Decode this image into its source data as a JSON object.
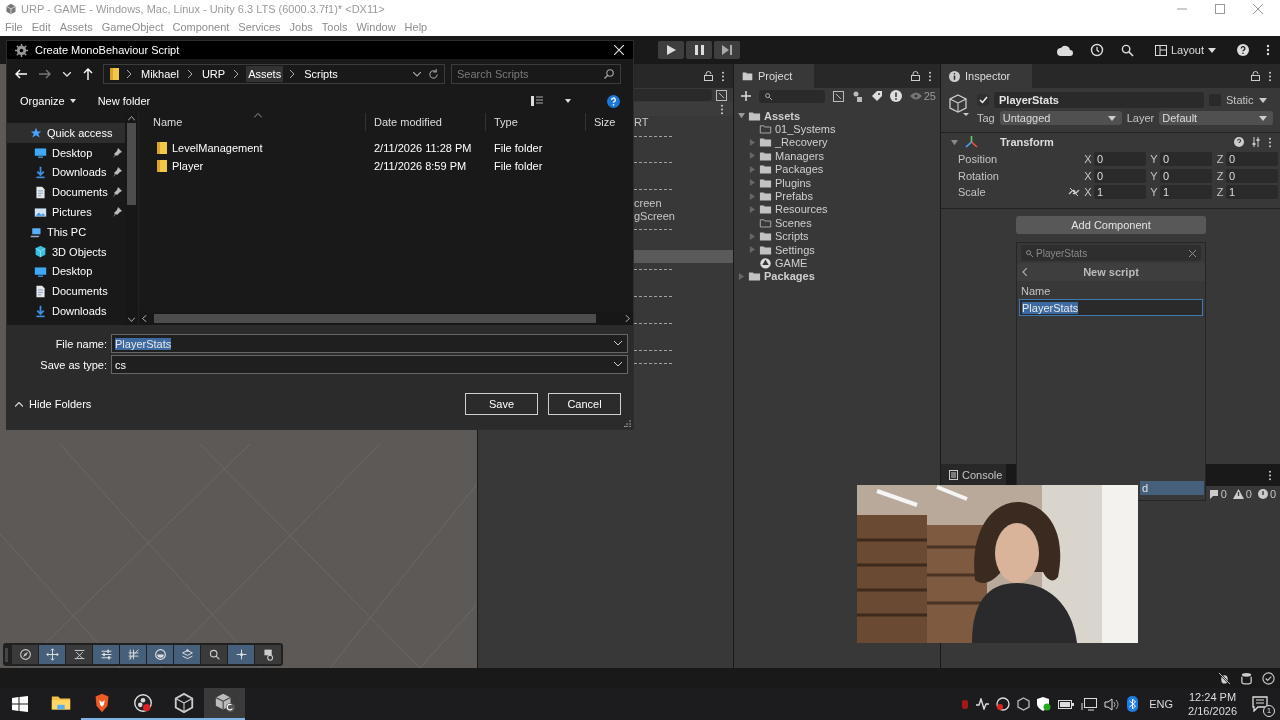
{
  "window": {
    "title": "URP - GAME - Windows, Mac, Linux - Unity 6.3 LTS (6000.3.7f1)* <DX11>"
  },
  "menu": [
    "File",
    "Edit",
    "Assets",
    "GameObject",
    "Component",
    "Services",
    "Jobs",
    "Tools",
    "Window",
    "Help"
  ],
  "toolbar": {
    "layout": "Layout"
  },
  "hierarchy": {
    "rows": [
      {
        "kind": "label",
        "text": "RT"
      },
      {
        "kind": "separator"
      },
      {
        "kind": "blank",
        "selected": false
      },
      {
        "kind": "separator"
      },
      {
        "kind": "blank",
        "selected": false
      },
      {
        "kind": "separator"
      },
      {
        "kind": "label",
        "text": "creen"
      },
      {
        "kind": "label",
        "text": "gScreen"
      },
      {
        "kind": "separator"
      },
      {
        "kind": "blank",
        "selected": false
      },
      {
        "kind": "blank",
        "selected": true
      },
      {
        "kind": "separator"
      },
      {
        "kind": "blank",
        "selected": false
      },
      {
        "kind": "separator"
      },
      {
        "kind": "blank",
        "selected": false
      },
      {
        "kind": "separator"
      },
      {
        "kind": "blank",
        "selected": false
      },
      {
        "kind": "separator"
      },
      {
        "kind": "separator"
      }
    ]
  },
  "project": {
    "tab": "Project",
    "count": "25",
    "tree": [
      {
        "label": "Assets",
        "kind": "folder",
        "expanded": true,
        "children": [
          {
            "label": "01_Systems",
            "kind": "empty-folder"
          },
          {
            "label": "_Recovery",
            "kind": "folder",
            "expanded": false
          },
          {
            "label": "Managers",
            "kind": "folder",
            "expanded": false
          },
          {
            "label": "Packages",
            "kind": "folder",
            "expanded": false
          },
          {
            "label": "Plugins",
            "kind": "folder",
            "expanded": false
          },
          {
            "label": "Prefabs",
            "kind": "folder",
            "expanded": false
          },
          {
            "label": "Resources",
            "kind": "folder",
            "expanded": false
          },
          {
            "label": "Scenes",
            "kind": "empty-folder"
          },
          {
            "label": "Scripts",
            "kind": "folder",
            "expanded": false
          },
          {
            "label": "Settings",
            "kind": "folder",
            "expanded": false
          },
          {
            "label": "GAME",
            "kind": "scene"
          }
        ]
      },
      {
        "label": "Packages",
        "kind": "folder",
        "expanded": false
      }
    ]
  },
  "inspector": {
    "tab": "Inspector",
    "name": "PlayerStats",
    "active": true,
    "static_label": "Static",
    "static": false,
    "tag_label": "Tag",
    "tag": "Untagged",
    "layer_label": "Layer",
    "layer": "Default",
    "component": {
      "title": "Transform",
      "expanded": true,
      "rows": [
        {
          "label": "Position",
          "linked": false,
          "fields": [
            {
              "axis": "X",
              "value": "0"
            },
            {
              "axis": "Y",
              "value": "0"
            },
            {
              "axis": "Z",
              "value": "0"
            }
          ]
        },
        {
          "label": "Rotation",
          "linked": false,
          "fields": [
            {
              "axis": "X",
              "value": "0"
            },
            {
              "axis": "Y",
              "value": "0"
            },
            {
              "axis": "Z",
              "value": "0"
            }
          ]
        },
        {
          "label": "Scale",
          "linked": true,
          "fields": [
            {
              "axis": "X",
              "value": "1"
            },
            {
              "axis": "Y",
              "value": "1"
            },
            {
              "axis": "Z",
              "value": "1"
            }
          ]
        }
      ]
    },
    "add_component": "Add Component"
  },
  "add_component_popup": {
    "search": "PlayerStats",
    "title": "New script",
    "name_label": "Name",
    "name_value": "PlayerStats",
    "create_button": "d"
  },
  "console": {
    "tab": "Console",
    "counts": [
      "0",
      "0",
      "0"
    ]
  },
  "scene_tools": [
    {
      "kind": "compass",
      "selected": false
    },
    {
      "kind": "move",
      "selected": true
    },
    {
      "kind": "transform",
      "selected": false
    },
    {
      "kind": "sliders",
      "selected": true
    },
    {
      "kind": "grid",
      "selected": true
    },
    {
      "kind": "orbit",
      "selected": true
    },
    {
      "kind": "plane",
      "selected": true
    },
    {
      "kind": "search",
      "selected": false
    },
    {
      "kind": "pivot",
      "selected": true
    },
    {
      "kind": "camera",
      "selected": false
    }
  ],
  "dialog": {
    "title": "Create MonoBehaviour Script",
    "breadcrumb": [
      {
        "label": "Mikhael",
        "hovered": false
      },
      {
        "label": "URP",
        "hovered": false
      },
      {
        "label": "Assets",
        "hovered": true
      },
      {
        "label": "Scripts",
        "hovered": false
      }
    ],
    "search_placeholder": "Search Scripts",
    "organize": "Organize",
    "new_folder": "New folder",
    "nav": [
      {
        "label": "Quick access",
        "kind": "star",
        "selected": true,
        "children": [
          {
            "label": "Desktop",
            "kind": "desktop",
            "selected": false,
            "pinned": true
          },
          {
            "label": "Downloads",
            "kind": "download",
            "selected": false,
            "pinned": true
          },
          {
            "label": "Documents",
            "kind": "document",
            "selected": false,
            "pinned": true
          },
          {
            "label": "Pictures",
            "kind": "pictures",
            "selected": false,
            "pinned": true
          }
        ]
      },
      {
        "label": "This PC",
        "kind": "pc",
        "selected": false,
        "children": [
          {
            "label": "3D Objects",
            "kind": "cube",
            "selected": false,
            "pinned": false
          },
          {
            "label": "Desktop",
            "kind": "desktop",
            "selected": false,
            "pinned": false
          },
          {
            "label": "Documents",
            "kind": "document",
            "selected": false,
            "pinned": false
          },
          {
            "label": "Downloads",
            "kind": "download",
            "selected": false,
            "pinned": false
          }
        ]
      }
    ],
    "columns": [
      "Name",
      "Date modified",
      "Type",
      "Size"
    ],
    "rows": [
      {
        "name": "LevelManagement",
        "date": "2/11/2026 11:28 PM",
        "type": "File folder"
      },
      {
        "name": "Player",
        "date": "2/11/2026 8:59 PM",
        "type": "File folder"
      }
    ],
    "file_name_label": "File name:",
    "file_name": "PlayerStats",
    "save_type_label": "Save as type:",
    "save_type": "cs",
    "hide_folders": "Hide Folders",
    "save": "Save",
    "cancel": "Cancel"
  },
  "webcam": {
    "kind": "picture"
  },
  "taskbar": {
    "apps": [
      {
        "kind": "files",
        "open": false,
        "selected": false
      },
      {
        "kind": "brave",
        "open": true,
        "selected": false
      },
      {
        "kind": "obs",
        "open": true,
        "selected": false
      },
      {
        "kind": "hub",
        "open": true,
        "selected": false
      },
      {
        "kind": "unity",
        "open": true,
        "selected": true
      }
    ],
    "language": "ENG",
    "time": "12:24 PM",
    "date": "2/16/2026",
    "notifications": "1"
  }
}
